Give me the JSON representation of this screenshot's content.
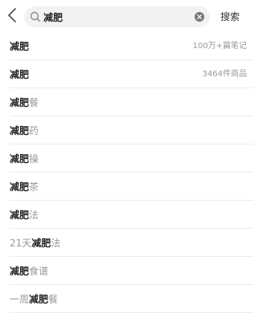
{
  "header": {
    "search_value": "减肥",
    "search_button_label": "搜索"
  },
  "suggestions": [
    {
      "prefix": "",
      "keyword": "减肥",
      "suffix": "",
      "meta": "100万+篇笔记"
    },
    {
      "prefix": "",
      "keyword": "减肥",
      "suffix": "",
      "meta": "3464件商品"
    },
    {
      "prefix": "",
      "keyword": "减肥",
      "suffix": "餐",
      "meta": ""
    },
    {
      "prefix": "",
      "keyword": "减肥",
      "suffix": "药",
      "meta": ""
    },
    {
      "prefix": "",
      "keyword": "减肥",
      "suffix": "操",
      "meta": ""
    },
    {
      "prefix": "",
      "keyword": "减肥",
      "suffix": "茶",
      "meta": ""
    },
    {
      "prefix": "",
      "keyword": "减肥",
      "suffix": "法",
      "meta": ""
    },
    {
      "prefix": "21天",
      "keyword": "减肥",
      "suffix": "法",
      "meta": ""
    },
    {
      "prefix": "",
      "keyword": "减肥",
      "suffix": "食谱",
      "meta": ""
    },
    {
      "prefix": "一周",
      "keyword": "减肥",
      "suffix": "餐",
      "meta": ""
    }
  ],
  "icons": {
    "back": "chevron-left-icon",
    "search": "search-icon",
    "clear": "clear-circle-icon"
  },
  "colors": {
    "search_box_bg": "#f2f2f2",
    "keyword": "#222222",
    "secondary": "#999999",
    "divider": "#ececec"
  }
}
